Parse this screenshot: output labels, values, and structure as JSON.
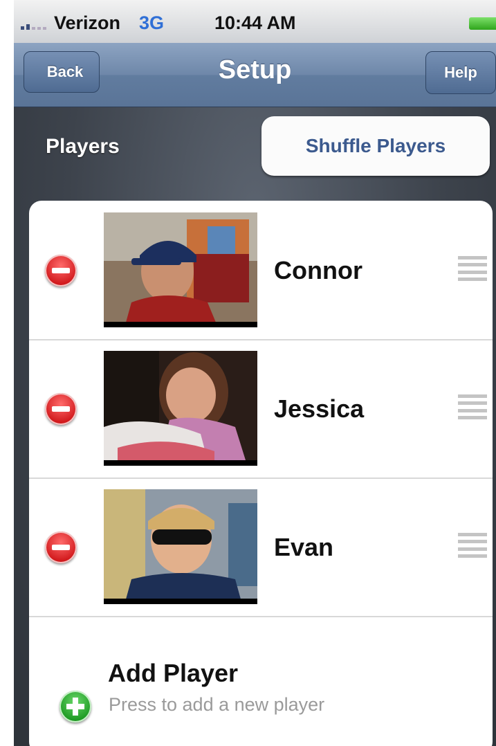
{
  "status_bar": {
    "carrier": "Verizon",
    "network": "3G",
    "time": "10:44 AM",
    "battery_level": 1.0
  },
  "nav": {
    "back_label": "Back",
    "title": "Setup",
    "help_label": "Help"
  },
  "players_section": {
    "title": "Players",
    "shuffle_label": "Shuffle Players"
  },
  "players": [
    {
      "name": "Connor"
    },
    {
      "name": "Jessica"
    },
    {
      "name": "Evan"
    }
  ],
  "add_player": {
    "title": "Add Player",
    "subtitle": "Press to add a new player"
  },
  "icons": {
    "delete": "minus-circle-red-icon",
    "add": "plus-circle-green-icon",
    "reorder": "drag-handle-icon"
  }
}
